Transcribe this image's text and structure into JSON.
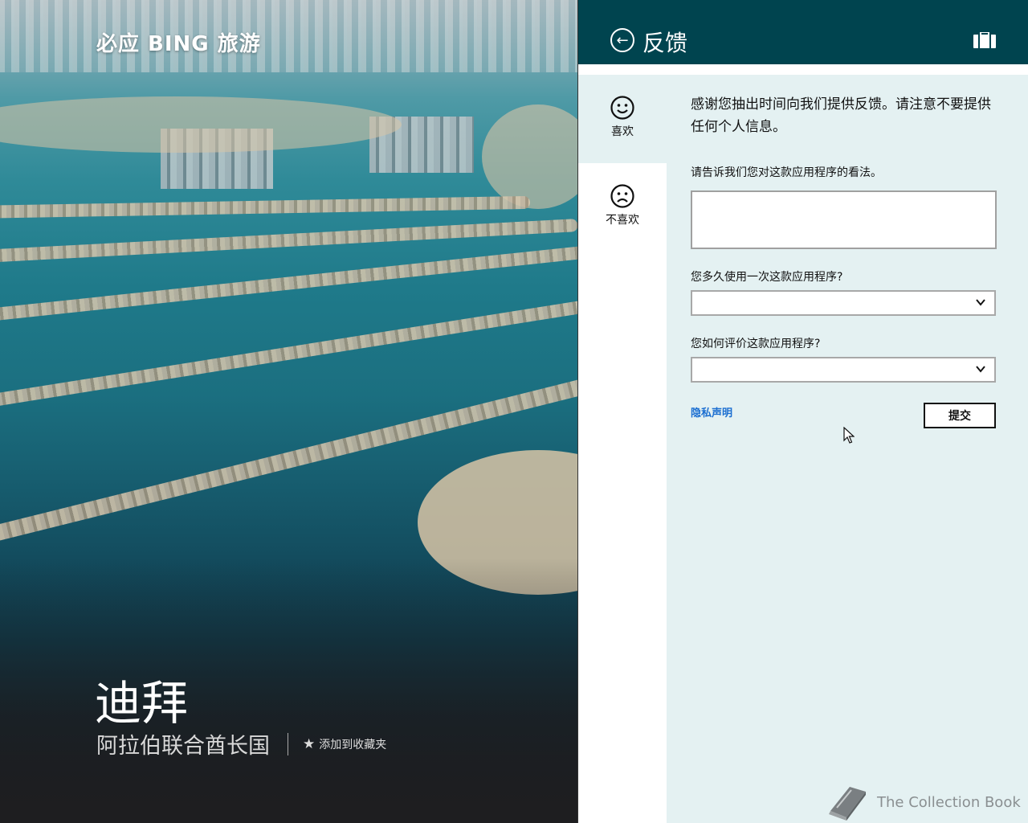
{
  "hero": {
    "app_title": "必应 BING 旅游",
    "city": "迪拜",
    "country": "阿拉伯联合酋长国",
    "favorite_label": "添加到收藏夹",
    "favorite_icon": "star-icon"
  },
  "feedback": {
    "title": "反馈",
    "back_icon": "back-arrow-icon",
    "header_icon": "briefcase-icon",
    "sentiment": {
      "like_label": "喜欢",
      "dislike_label": "不喜欢",
      "selected": "like"
    },
    "intro": "感谢您抽出时间向我们提供反馈。请注意不要提供任何个人信息。",
    "q_opinion": "请告诉我们您对这款应用程序的看法。",
    "opinion_value": "",
    "q_frequency": "您多久使用一次这款应用程序?",
    "frequency_value": "",
    "q_rating": "您如何评价这款应用程序?",
    "rating_value": "",
    "privacy_link": "隐私声明",
    "submit_label": "提交"
  },
  "watermark": {
    "text": "The Collection Book",
    "icon": "book-icon"
  },
  "colors": {
    "header_bg": "#00444f",
    "pane_bg": "#e4f1f2",
    "link": "#1c6fd1"
  }
}
